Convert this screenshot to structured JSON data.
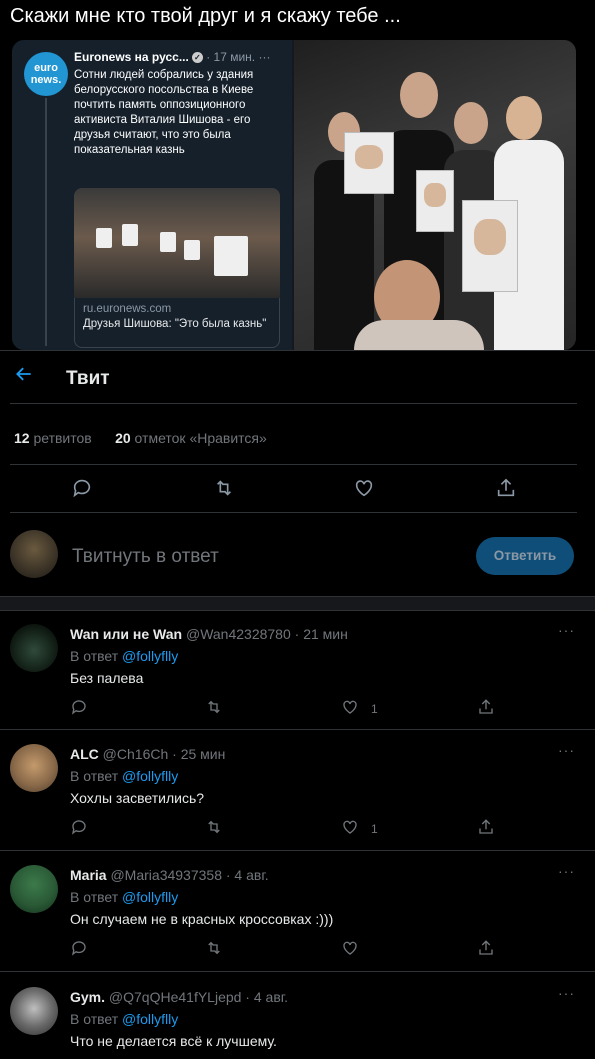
{
  "caption": "Скажи мне кто твой друг и я скажу тебе ...",
  "embed": {
    "logo_line1": "euro",
    "logo_line2": "news.",
    "source": "Euronews на русс...",
    "time": "· 17 мин.",
    "more": "···",
    "text": "Сотни людей собрались у здания белорусского посольства в Киеве почтить память оппозиционного активиста Виталия Шишова - его друзья считают, что это была показательная казнь",
    "link_domain": "ru.euronews.com",
    "link_title": "Друзья Шишова: \"Это была казнь\""
  },
  "header": {
    "back_icon": "arrow-left-icon",
    "title": "Твит"
  },
  "stats": {
    "retweets_count": "12",
    "retweets_label": "ретвитов",
    "likes_count": "20",
    "likes_label": "отметок «Нравится»"
  },
  "compose": {
    "placeholder": "Твитнуть в ответ",
    "button": "Ответить"
  },
  "replies": [
    {
      "name": "Wan или не Wan",
      "handle": "@Wan42328780 · 21 мин",
      "reply_to_prefix": "В ответ",
      "reply_to": "@follyflly",
      "text": "Без палева",
      "likes": "1",
      "more": "···"
    },
    {
      "name": "ALC",
      "handle": "@Ch16Ch · 25 мин",
      "reply_to_prefix": "В ответ",
      "reply_to": "@follyflly",
      "text": "Хохлы засветились?",
      "likes": "1",
      "more": "···"
    },
    {
      "name": "Maria",
      "handle": "@Maria34937358 · 4 авг.",
      "reply_to_prefix": "В ответ",
      "reply_to": "@follyflly",
      "text": "Он случаем не в красных кроссовках :)))",
      "likes": "",
      "more": "···"
    },
    {
      "name": "Gym.",
      "handle": "@Q7qQHe41fYLjepd · 4 авг.",
      "reply_to_prefix": "В ответ",
      "reply_to": "@follyflly",
      "text": "Что не делается всё к лучшему.",
      "likes": "",
      "more": "···"
    }
  ],
  "colors": {
    "accent": "#1d9bf0",
    "background": "#000000",
    "muted": "#71767b"
  }
}
